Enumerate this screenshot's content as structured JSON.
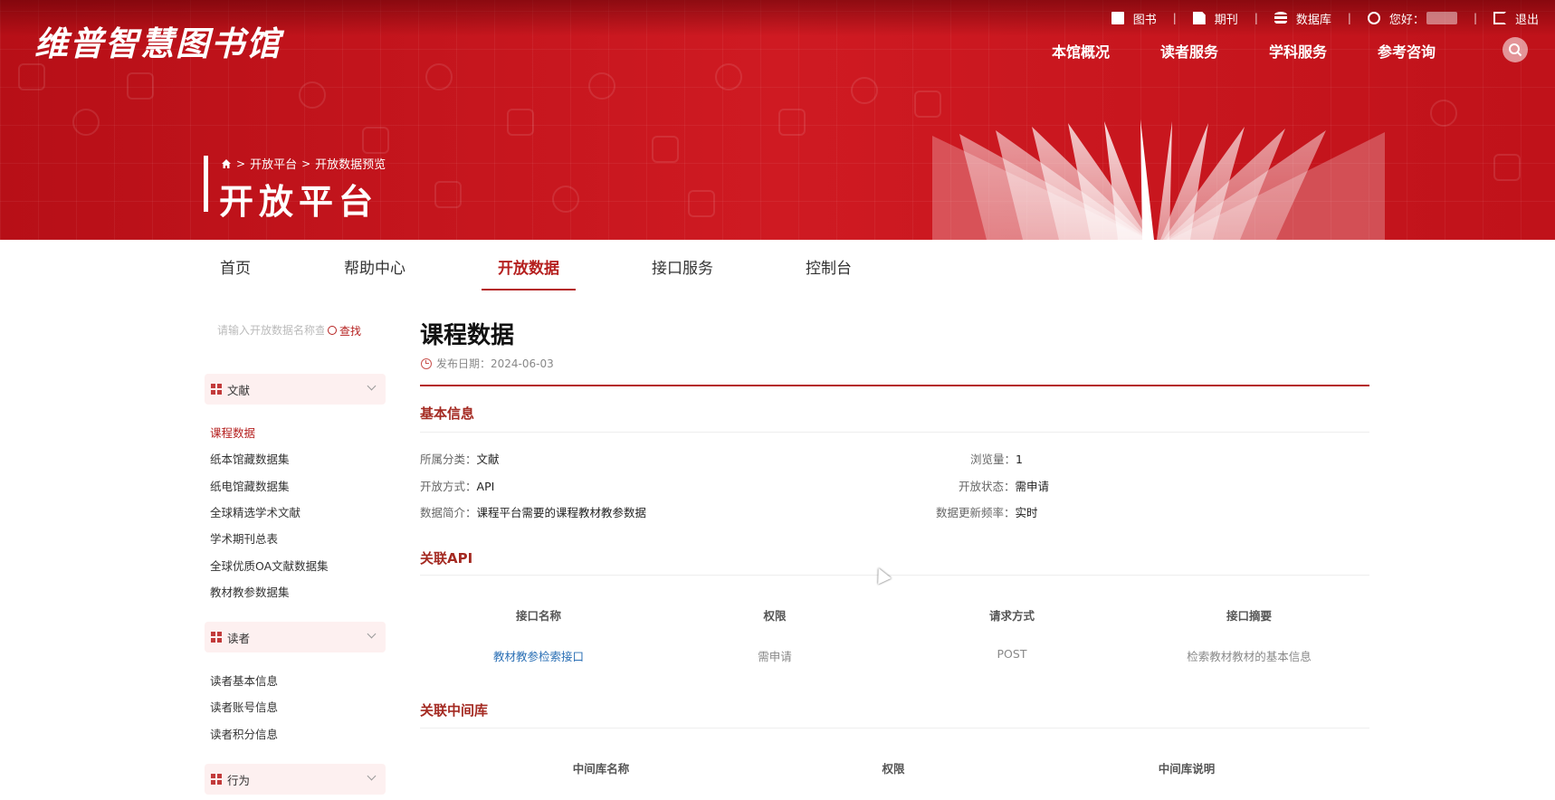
{
  "site": {
    "logo_text": "维普智慧图书馆"
  },
  "topbar": {
    "items": [
      {
        "label": "图书",
        "icon": "book-icon"
      },
      {
        "label": "期刊",
        "icon": "journal-icon"
      },
      {
        "label": "数据库",
        "icon": "database-icon"
      },
      {
        "label": "您好：",
        "icon": "user-icon"
      },
      {
        "label": "退出",
        "icon": "logout-icon"
      }
    ]
  },
  "mainnav": [
    "本馆概况",
    "读者服务",
    "学科服务",
    "参考咨询"
  ],
  "breadcrumb": [
    "开放平台",
    "开放数据预览"
  ],
  "page_heading": "开放平台",
  "subnav": {
    "items": [
      "首页",
      "帮助中心",
      "开放数据",
      "接口服务",
      "控制台"
    ],
    "active": "开放数据"
  },
  "sidebar": {
    "search": {
      "placeholder": "请输入开放数据名称查询",
      "button": "查找"
    },
    "categories": [
      {
        "label": "文献",
        "items": [
          "课程数据",
          "纸本馆藏数据集",
          "纸电馆藏数据集",
          "全球精选学术文献",
          "学术期刊总表",
          "全球优质OA文献数据集",
          "教材教参数据集"
        ]
      },
      {
        "label": "读者",
        "items": [
          "读者基本信息",
          "读者账号信息",
          "读者积分信息"
        ]
      },
      {
        "label": "行为",
        "items": []
      }
    ],
    "active_item": "课程数据"
  },
  "main": {
    "title": "课程数据",
    "pubdate_label": "发布日期：",
    "pubdate": "2024-06-03",
    "basic_info": {
      "title": "基本信息",
      "fields": {
        "category": {
          "label": "所属分类：",
          "value": "文献"
        },
        "views": {
          "label": "浏览量：",
          "value": "1"
        },
        "open_mode": {
          "label": "开放方式：",
          "value": "API"
        },
        "open_status": {
          "label": "开放状态：",
          "value": "需申请"
        },
        "summary": {
          "label": "数据简介：",
          "value": "课程平台需要的课程教材教参数据"
        },
        "frequency": {
          "label": "数据更新频率：",
          "value": "实时"
        }
      }
    },
    "api": {
      "title": "关联API",
      "columns": [
        "接口名称",
        "权限",
        "请求方式",
        "接口摘要"
      ],
      "rows": [
        [
          "教材教参检索接口",
          "需申请",
          "POST",
          "检索教材教材的基本信息"
        ]
      ]
    },
    "middleware": {
      "title": "关联中间库",
      "columns": [
        "中间库名称",
        "权限",
        "中间库说明"
      ]
    }
  },
  "colors": {
    "brand_red": "#c8151d",
    "accent": "#b5201f",
    "link": "#2a6fb5"
  }
}
